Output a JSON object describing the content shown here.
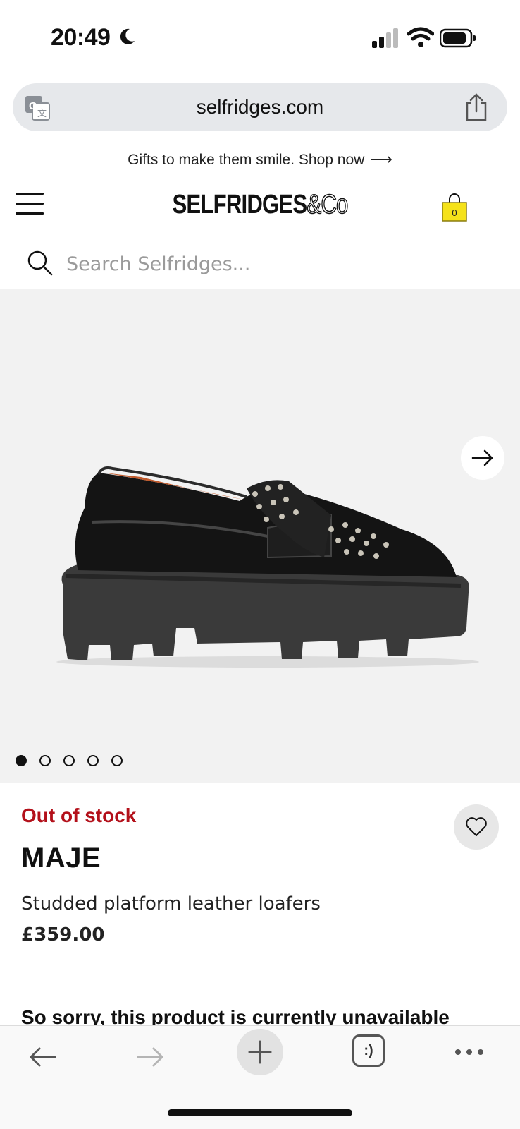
{
  "status_bar": {
    "time": "20:49"
  },
  "browser": {
    "url": "selfridges.com"
  },
  "promo": {
    "text": "Gifts to make them smile. Shop now"
  },
  "header": {
    "logo_main": "SELFRIDGES",
    "logo_suffix": "&Co",
    "bag_count": "0"
  },
  "search": {
    "placeholder": "Search Selfridges..."
  },
  "gallery": {
    "slide_count": 5,
    "active_slide": 1
  },
  "product": {
    "stock_status": "Out of stock",
    "brand": "MAJE",
    "name": "Studded platform leather loafers",
    "price": "£359.00",
    "unavailable_message": "So sorry, this product is currently unavailable"
  },
  "toolbar": {
    "tabs_label": ":)"
  },
  "colors": {
    "stock_red": "#b3101a",
    "bag_yellow": "#f5e21a"
  }
}
